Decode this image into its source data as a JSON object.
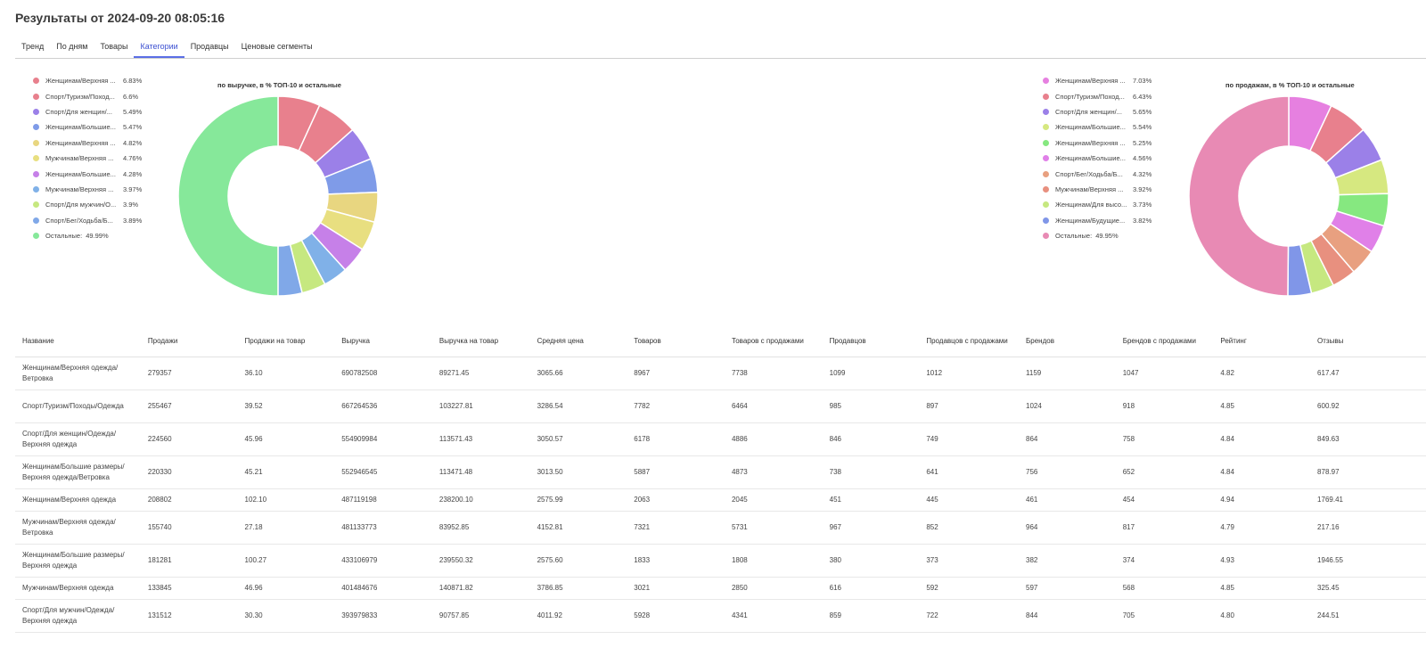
{
  "header": {
    "title": "Результаты от 2024-09-20 08:05:16"
  },
  "tabs": [
    {
      "label": "Тренд",
      "active": false
    },
    {
      "label": "По дням",
      "active": false
    },
    {
      "label": "Товары",
      "active": false
    },
    {
      "label": "Категории",
      "active": true
    },
    {
      "label": "Продавцы",
      "active": false
    },
    {
      "label": "Ценовые сегменты",
      "active": false
    }
  ],
  "chart_data": [
    {
      "type": "pie",
      "title": "по выручке, в % ТОП-10 и остальные",
      "labels": [
        "Женщинам/Верхняя ...",
        "Спорт/Туризм/Поход...",
        "Спорт/Для женщин/...",
        "Женщинам/Большие...",
        "Женщинам/Верхняя ...",
        "Мужчинам/Верхняя ...",
        "Женщинам/Большие...",
        "Мужчинам/Верхняя ...",
        "Спорт/Для мужчин/О...",
        "Спорт/Бег/Ходьба/Б...",
        "Остальные:"
      ],
      "display_values": [
        "6.83%",
        "6.6%",
        "5.49%",
        "5.47%",
        "4.82%",
        "4.76%",
        "4.28%",
        "3.97%",
        "3.9%",
        "3.89%",
        "49.99%"
      ],
      "values": [
        6.83,
        6.6,
        5.49,
        5.47,
        4.82,
        4.76,
        4.28,
        3.97,
        3.9,
        3.89,
        49.99
      ],
      "colors": [
        "#e8808d",
        "#e8808d",
        "#9b80e8",
        "#7f9be8",
        "#e8d680",
        "#e8df80",
        "#c680e8",
        "#80b1e8",
        "#c6e880",
        "#80a8e8",
        "#86e89a"
      ],
      "legend": "left"
    },
    {
      "type": "pie",
      "title": "по продажам, в % ТОП-10 и остальные",
      "labels": [
        "Женщинам/Верхняя ...",
        "Спорт/Туризм/Поход...",
        "Спорт/Для женщин/...",
        "Женщинам/Большие...",
        "Женщинам/Верхняя ...",
        "Женщинам/Большие...",
        "Спорт/Бег/Ходьба/Б...",
        "Мужчинам/Верхняя ...",
        "Женщинам/Для высо...",
        "Женщинам/Будущие..."
      ],
      "display_values": [
        "7.03%",
        "6.43%",
        "5.65%",
        "5.54%",
        "5.25%",
        "4.56%",
        "4.32%",
        "3.92%",
        "3.73%",
        "3.82%"
      ],
      "values": [
        7.03,
        6.43,
        5.65,
        5.54,
        5.25,
        4.56,
        4.32,
        3.92,
        3.73,
        3.82
      ],
      "other_label": "Остальные:",
      "other_display": "49.95%",
      "other_value": 49.95,
      "colors": [
        "#e680e0",
        "#e8808d",
        "#9b80e8",
        "#d6e880",
        "#86e880",
        "#e080e8",
        "#e8a080",
        "#e8907f",
        "#c6e880",
        "#8096e8"
      ],
      "other_color": "#e88ab4",
      "legend": "left"
    }
  ],
  "table": {
    "headers": [
      "Название",
      "Продажи",
      "Продажи на товар",
      "Выручка",
      "Выручка на товар",
      "Средняя цена",
      "Товаров",
      "Товаров с продажами",
      "Продавцов",
      "Продавцов с продажами",
      "Брендов",
      "Брендов с продажами",
      "Рейтинг",
      "Отзывы"
    ],
    "rows": [
      [
        "Женщинам/Верхняя одежда/Ветровка",
        "279357",
        "36.10",
        "690782508",
        "89271.45",
        "3065.66",
        "8967",
        "7738",
        "1099",
        "1012",
        "1159",
        "1047",
        "4.82",
        "617.47"
      ],
      [
        "Спорт/Туризм/Походы/Одежда",
        "255467",
        "39.52",
        "667264536",
        "103227.81",
        "3286.54",
        "7782",
        "6464",
        "985",
        "897",
        "1024",
        "918",
        "4.85",
        "600.92"
      ],
      [
        "Спорт/Для женщин/Одежда/Верхняя одежда",
        "224560",
        "45.96",
        "554909984",
        "113571.43",
        "3050.57",
        "6178",
        "4886",
        "846",
        "749",
        "864",
        "758",
        "4.84",
        "849.63"
      ],
      [
        "Женщинам/Большие размеры/Верхняя одежда/Ветровка",
        "220330",
        "45.21",
        "552946545",
        "113471.48",
        "3013.50",
        "5887",
        "4873",
        "738",
        "641",
        "756",
        "652",
        "4.84",
        "878.97"
      ],
      [
        "Женщинам/Верхняя одежда",
        "208802",
        "102.10",
        "487119198",
        "238200.10",
        "2575.99",
        "2063",
        "2045",
        "451",
        "445",
        "461",
        "454",
        "4.94",
        "1769.41"
      ],
      [
        "Мужчинам/Верхняя одежда/Ветровка",
        "155740",
        "27.18",
        "481133773",
        "83952.85",
        "4152.81",
        "7321",
        "5731",
        "967",
        "852",
        "964",
        "817",
        "4.79",
        "217.16"
      ],
      [
        "Женщинам/Большие размеры/Верхняя одежда",
        "181281",
        "100.27",
        "433106979",
        "239550.32",
        "2575.60",
        "1833",
        "1808",
        "380",
        "373",
        "382",
        "374",
        "4.93",
        "1946.55"
      ],
      [
        "Мужчинам/Верхняя одежда",
        "133845",
        "46.96",
        "401484676",
        "140871.82",
        "3786.85",
        "3021",
        "2850",
        "616",
        "592",
        "597",
        "568",
        "4.85",
        "325.45"
      ],
      [
        "Спорт/Для мужчин/Одежда/Верхняя одежда",
        "131512",
        "30.30",
        "393979833",
        "90757.85",
        "4011.92",
        "5928",
        "4341",
        "859",
        "722",
        "844",
        "705",
        "4.80",
        "244.51"
      ]
    ]
  }
}
